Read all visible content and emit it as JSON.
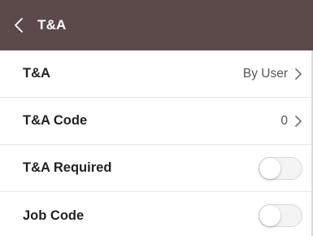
{
  "header": {
    "title": "T&A",
    "back_icon": "chevron-left-icon",
    "background_color": "#5b4a49"
  },
  "rows": [
    {
      "label": "T&A",
      "value": "By User",
      "control": "chevron"
    },
    {
      "label": "T&A Code",
      "value": "0",
      "control": "chevron"
    },
    {
      "label": "T&A Required",
      "control": "toggle",
      "state": "off"
    },
    {
      "label": "Job Code",
      "control": "toggle",
      "state": "off"
    }
  ]
}
